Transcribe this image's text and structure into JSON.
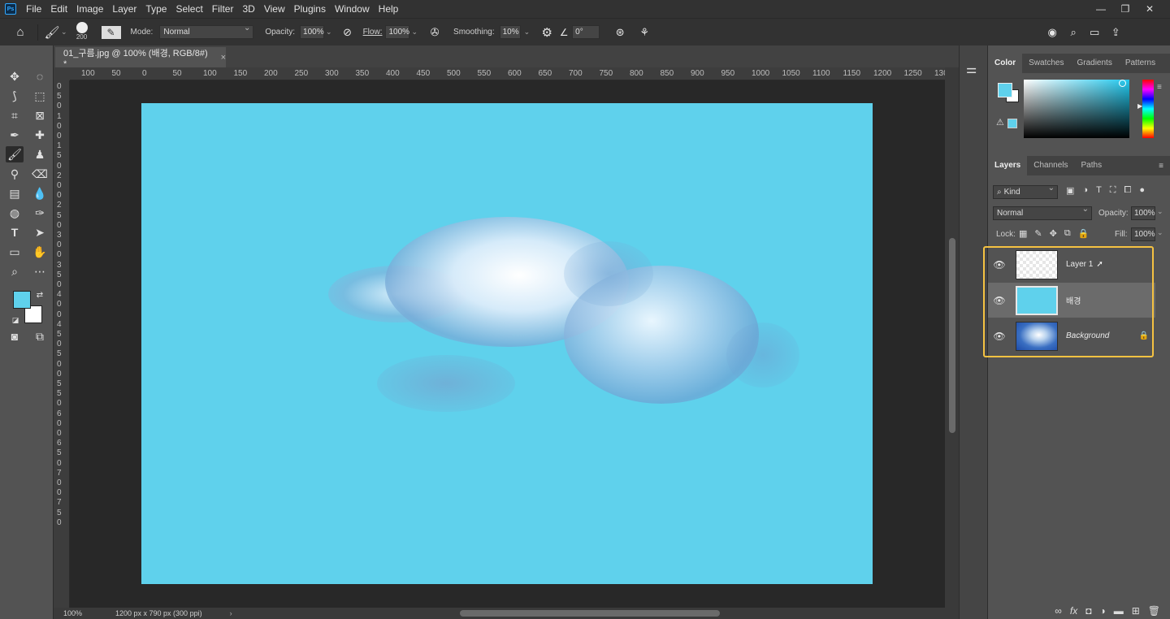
{
  "menubar": {
    "logo": "Ps",
    "items": [
      "File",
      "Edit",
      "Image",
      "Layer",
      "Type",
      "Select",
      "Filter",
      "3D",
      "View",
      "Plugins",
      "Window",
      "Help"
    ],
    "window_controls": [
      "—",
      "❐",
      "✕"
    ]
  },
  "options_bar": {
    "brush_size": "200",
    "mode_label": "Mode:",
    "mode_value": "Normal",
    "opacity_label": "Opacity:",
    "opacity_value": "100%",
    "flow_label": "Flow:",
    "flow_value": "100%",
    "smoothing_label": "Smoothing:",
    "smoothing_value": "10%",
    "angle_value": "0°"
  },
  "document": {
    "tab_title": "01_구름.jpg @ 100% (배경, RGB/8#) *",
    "zoom": "100%",
    "doc_info": "1200 px x 790 px (300 ppi)",
    "ruler_h": [
      "100",
      "50",
      "0",
      "50",
      "100",
      "150",
      "200",
      "250",
      "300",
      "350",
      "400",
      "450",
      "500",
      "550",
      "600",
      "650",
      "700",
      "750",
      "800",
      "850",
      "900",
      "950",
      "1000",
      "1050",
      "1100",
      "1150",
      "1200",
      "1250",
      "130"
    ],
    "ruler_v": [
      "0",
      "5",
      "0",
      "1",
      "0",
      "0",
      "1",
      "5",
      "0",
      "2",
      "0",
      "0",
      "2",
      "5",
      "0",
      "3",
      "0",
      "0",
      "3",
      "5",
      "0",
      "4",
      "0",
      "0",
      "4",
      "5",
      "0",
      "5",
      "0",
      "0",
      "5",
      "5",
      "0",
      "6",
      "0",
      "0",
      "6",
      "5",
      "0",
      "7",
      "0",
      "0",
      "7",
      "5",
      "0"
    ]
  },
  "colors": {
    "foreground": "#5fd1ec",
    "background": "#ffffff",
    "canvas": "#5fd1ec",
    "highlight": "#f5c242"
  },
  "color_panel": {
    "tabs": [
      "Color",
      "Swatches",
      "Gradients",
      "Patterns"
    ]
  },
  "layers_panel": {
    "tabs": [
      "Layers",
      "Channels",
      "Paths"
    ],
    "filter_kind": "Kind",
    "blend_mode": "Normal",
    "opacity_label": "Opacity:",
    "opacity_value": "100%",
    "lock_label": "Lock:",
    "fill_label": "Fill:",
    "fill_value": "100%",
    "layers": [
      {
        "name": "Layer 1",
        "visible": true,
        "selected": false
      },
      {
        "name": "배경",
        "visible": true,
        "selected": true
      },
      {
        "name": "Background",
        "visible": true,
        "selected": false,
        "locked": true
      }
    ]
  }
}
